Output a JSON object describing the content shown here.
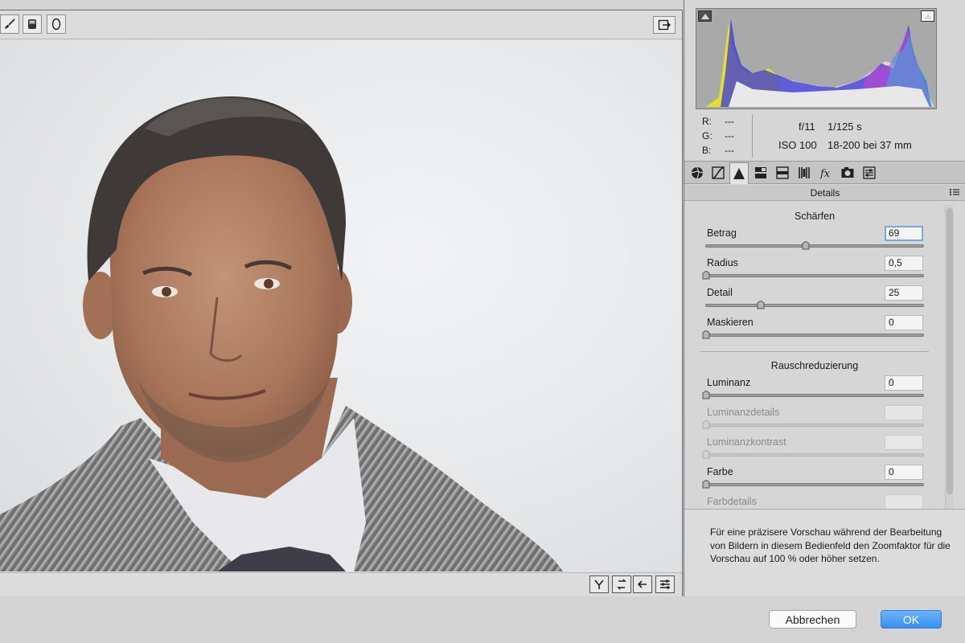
{
  "toolbar": {
    "tools": [
      {
        "icon": "brush-icon"
      },
      {
        "icon": "graduated-filter-icon"
      },
      {
        "icon": "radial-filter-icon"
      }
    ],
    "toggle_fullscreen_icon": "fullscreen-toggle-icon"
  },
  "preview_bottom_tools": [
    {
      "icon": "y-compare-icon"
    },
    {
      "icon": "swap-settings-icon"
    },
    {
      "icon": "copy-settings-icon"
    },
    {
      "icon": "preview-preferences-icon"
    }
  ],
  "info": {
    "r_label": "R:",
    "r_value": "---",
    "g_label": "G:",
    "g_value": "---",
    "b_label": "B:",
    "b_value": "---",
    "aperture": "f/11",
    "shutter": "1/125 s",
    "iso": "ISO 100",
    "lens": "18-200 bei 37 mm"
  },
  "tabs": [
    {
      "icon": "basic-aperture-icon"
    },
    {
      "icon": "tone-curve-icon"
    },
    {
      "icon": "detail-triangle-icon",
      "active": true
    },
    {
      "icon": "hsl-icon"
    },
    {
      "icon": "split-toning-icon"
    },
    {
      "icon": "lens-corrections-icon"
    },
    {
      "icon": "effects-fx-icon"
    },
    {
      "icon": "camera-calibration-icon"
    },
    {
      "icon": "presets-icon"
    }
  ],
  "panel": {
    "title": "Details",
    "sharpen_title": "Schärfen",
    "noise_title": "Rauschreduzierung",
    "sharpen": [
      {
        "label": "Betrag",
        "value": "69",
        "level": 0.46,
        "focused": true
      },
      {
        "label": "Radius",
        "value": "0,5",
        "level": 0.0
      },
      {
        "label": "Detail",
        "value": "25",
        "level": 0.25
      },
      {
        "label": "Maskieren",
        "value": "0",
        "level": 0.0
      }
    ],
    "noise": [
      {
        "label": "Luminanz",
        "value": "0",
        "level": 0.0
      },
      {
        "label": "Luminanzdetails",
        "value": "",
        "level": 0.0,
        "disabled": true
      },
      {
        "label": "Luminanzkontrast",
        "value": "",
        "level": 0.0,
        "disabled": true
      },
      {
        "label": "Farbe",
        "value": "0",
        "level": 0.0
      },
      {
        "label": "Farbdetails",
        "value": "",
        "level": 0.0,
        "disabled": true
      }
    ]
  },
  "hint": {
    "text": "Für eine präzisere Vorschau während der Bearbeitung von Bildern in diesem Bedienfeld den Zoomfaktor für die Vorschau auf 100 % oder höher setzen."
  },
  "buttons": {
    "cancel": "Abbrechen",
    "ok": "OK"
  },
  "colors": {
    "ok_blue": "#3a8ef0",
    "histogram_bg": "#a9a9a9",
    "focus_ring": "#7fa8d9"
  }
}
